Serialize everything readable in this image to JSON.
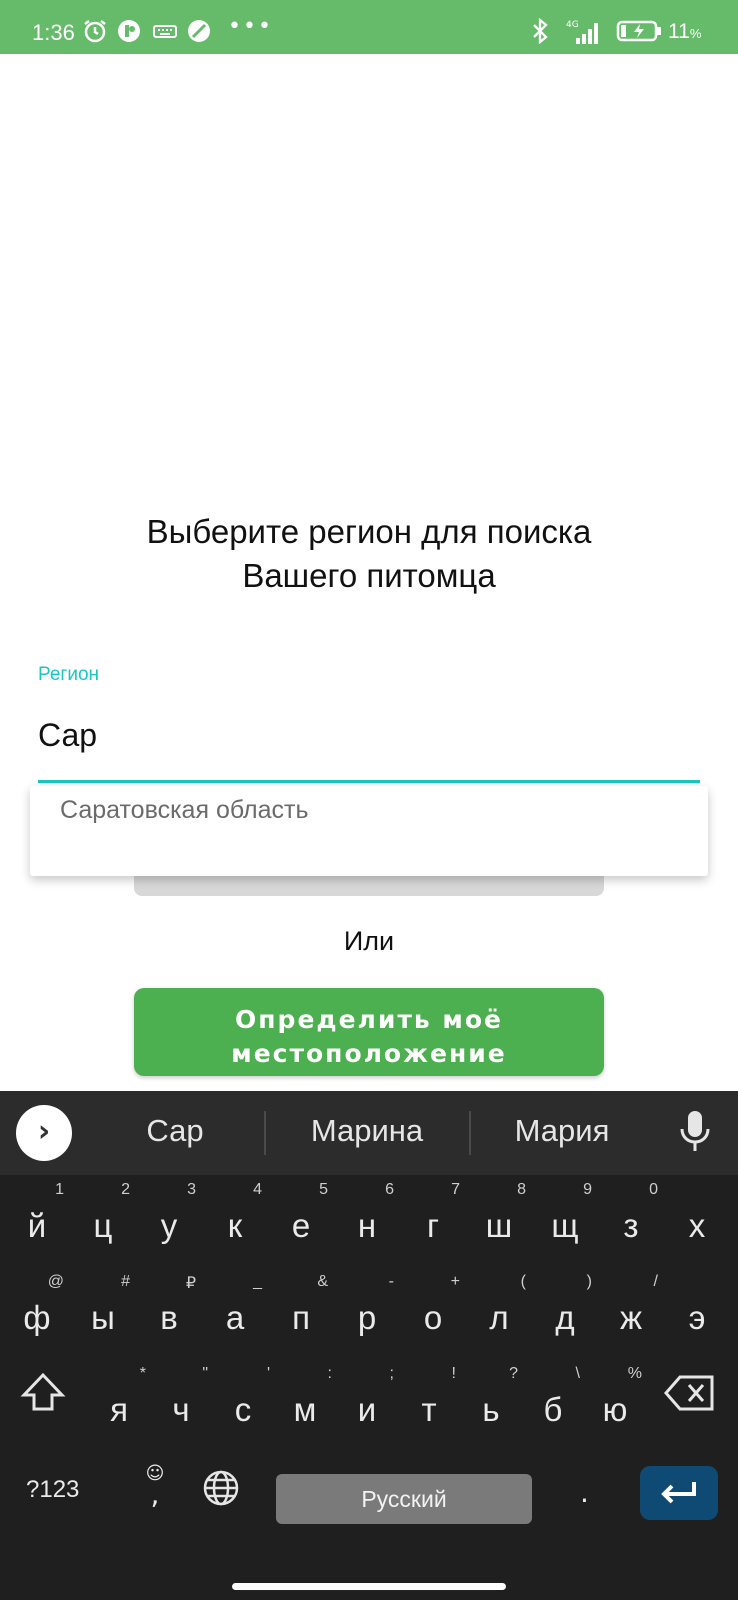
{
  "status_bar": {
    "time": "1:36",
    "battery_percent": "11",
    "battery_percent_sign": "%",
    "network_label": "4G",
    "background_color": "#66bb6a"
  },
  "page": {
    "heading_line1": "Выберите регион для поиска",
    "heading_line2": "Вашего питомца",
    "region_field": {
      "label": "Регион",
      "value": "Сар"
    },
    "autocomplete": {
      "items": [
        "Саратовская область"
      ]
    },
    "or_label": "Или",
    "locate_button": {
      "line1": "Определить моё",
      "line2": "местоположение",
      "color": "#4caf50"
    },
    "accent_color": "#1bc6c0"
  },
  "keyboard": {
    "suggestions": [
      "Сар",
      "Марина",
      "Мария"
    ],
    "row1": [
      {
        "k": "й",
        "a": "1"
      },
      {
        "k": "ц",
        "a": "2"
      },
      {
        "k": "у",
        "a": "3"
      },
      {
        "k": "к",
        "a": "4"
      },
      {
        "k": "е",
        "a": "5"
      },
      {
        "k": "н",
        "a": "6"
      },
      {
        "k": "г",
        "a": "7"
      },
      {
        "k": "ш",
        "a": "8"
      },
      {
        "k": "щ",
        "a": "9"
      },
      {
        "k": "з",
        "a": "0"
      },
      {
        "k": "х",
        "a": ""
      }
    ],
    "row2": [
      {
        "k": "ф",
        "a": "@"
      },
      {
        "k": "ы",
        "a": "#"
      },
      {
        "k": "в",
        "a": "₽"
      },
      {
        "k": "а",
        "a": "_"
      },
      {
        "k": "п",
        "a": "&"
      },
      {
        "k": "р",
        "a": "-"
      },
      {
        "k": "о",
        "a": "+"
      },
      {
        "k": "л",
        "a": "("
      },
      {
        "k": "д",
        "a": ")"
      },
      {
        "k": "ж",
        "a": "/"
      },
      {
        "k": "э",
        "a": ""
      }
    ],
    "row3": [
      {
        "k": "я",
        "a": "*"
      },
      {
        "k": "ч",
        "a": "\""
      },
      {
        "k": "с",
        "a": "'"
      },
      {
        "k": "м",
        "a": ":"
      },
      {
        "k": "и",
        "a": ";"
      },
      {
        "k": "т",
        "a": "!"
      },
      {
        "k": "ь",
        "a": "?"
      },
      {
        "k": "б",
        "a": "\\"
      },
      {
        "k": "ю",
        "a": "%"
      }
    ],
    "symbols_key": "?123",
    "comma_key": ",",
    "space_label": "Русский",
    "period_key": ".",
    "icons": [
      "chevron-right-icon",
      "mic-icon",
      "shift-icon",
      "backspace-icon",
      "emoji-icon",
      "globe-icon",
      "enter-icon"
    ]
  }
}
